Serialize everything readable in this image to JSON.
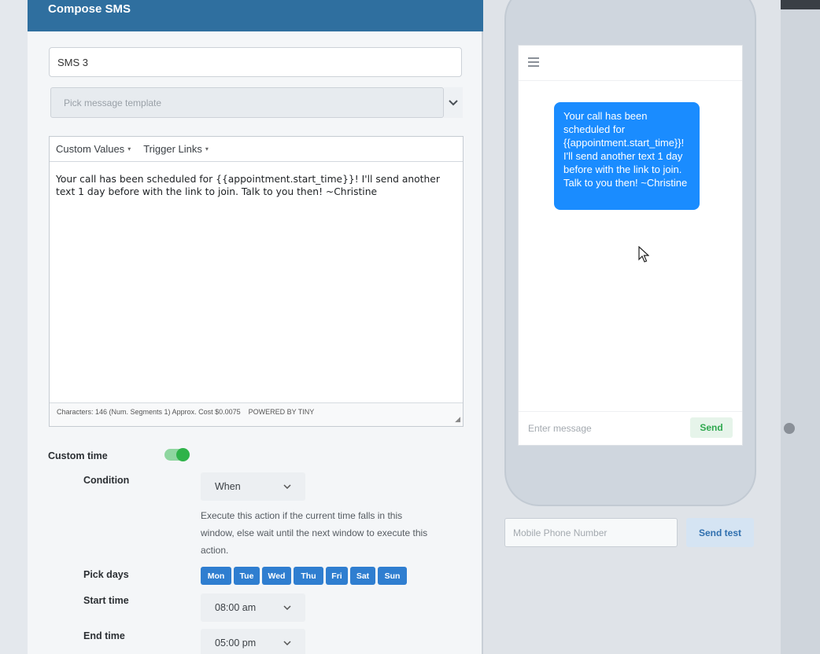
{
  "compose": {
    "title": "Compose SMS",
    "name_value": "SMS 3",
    "template_placeholder": "Pick message template",
    "toolbar": {
      "custom_values": "Custom Values",
      "trigger_links": "Trigger Links"
    },
    "body_text": "Your call has been scheduled for {{appointment.start_time}}! I'll send another text 1 day before with the link to join. Talk to you then! ~Christine",
    "status_text": "Characters: 146 (Num. Segments 1) Approx. Cost $0.0075",
    "powered_by": "POWERED BY TINY"
  },
  "custom_time": {
    "label": "Custom time",
    "enabled": true,
    "condition_label": "Condition",
    "condition_value": "When",
    "help_text": "Execute this action if the current time falls in this window, else wait until the next window to execute this action.",
    "pick_days_label": "Pick days",
    "days": [
      "Mon",
      "Tue",
      "Wed",
      "Thu",
      "Fri",
      "Sat",
      "Sun"
    ],
    "start_time_label": "Start time",
    "start_time_value": "08:00 am",
    "end_time_label": "End time",
    "end_time_value": "05:00 pm"
  },
  "preview": {
    "message": "Your call has been scheduled for {{appointment.start_time}}! I'll send another text 1 day before with the link to join. Talk to you then! ~Christine",
    "composer_placeholder": "Enter message",
    "send_label": "Send",
    "phone_placeholder": "Mobile Phone Number",
    "send_test_label": "Send test"
  },
  "colors": {
    "header": "#2f6f9f",
    "bubble": "#1a8cff",
    "day_button": "#2f7ed0",
    "toggle_on": "#2fb34a"
  }
}
